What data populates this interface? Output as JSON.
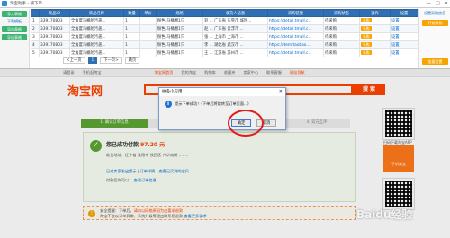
{
  "window": {
    "title": "淘宝助手 - 铺下单"
  },
  "left_panel": {
    "buttons": [
      {
        "label": "导入表格"
      },
      {
        "label": "下载模板"
      },
      {
        "label": "导出表格"
      },
      {
        "label": "导出表格"
      }
    ],
    "link": "下载模板"
  },
  "table": {
    "headers": [
      "",
      "商品ID",
      "商品名称",
      "数量",
      "单价",
      "规格",
      "收货人信息",
      "采购链接",
      "采购状态",
      "操作",
      "设置"
    ],
    "rows": [
      [
        "1",
        "339170803",
        "全角度马桶防汚盖...",
        "1",
        "",
        "粉色-马桶圈1只",
        "刘 ... 广东省 东莞市 城区...",
        "https://detail.tmall.c...",
        "待采购",
        "采购",
        "设置"
      ],
      [
        "2",
        "339170803",
        "全角度马桶防汚盖...",
        "1",
        "",
        "粉色-马桶圈1只",
        "赵 ... 广东省 云浮市 ...",
        "https://detail.tmall.c...",
        "待采购",
        "采购",
        "设置"
      ],
      [
        "3",
        "339170803",
        "全角度马桶防汚盖...",
        "1",
        "",
        "粉色-马桶圈1只",
        "张 ... 上海市 上海市 ...",
        "https://detail.tmall.c...",
        "待采购",
        "采购",
        "设置"
      ],
      [
        "4",
        "339170803",
        "全角度马桶防汚盖...",
        "1",
        "",
        "粉色-马桶圈1只",
        "李 ... 湖北省 武汉市 ...",
        "https://item.taobao....",
        "待采购",
        "采购",
        "设置"
      ],
      [
        "5",
        "339170803",
        "全角度马桶防汚盖...",
        "1",
        "",
        "粉色-马桶圈1只",
        "王 ... 江苏省 苏州市 ...",
        "https://detail.tmall.c...",
        "待采购",
        "采购",
        "设置"
      ]
    ]
  },
  "right_panel": {
    "title": "设置采购信息",
    "buttons": [
      "开始采购",
      "批量设置"
    ]
  },
  "pager": {
    "items": [
      "<上一页",
      "1",
      "下一页>",
      "跳页"
    ]
  },
  "web": {
    "topnav": [
      "淘宝网首页",
      "我的淘宝",
      "购物车",
      "收藏夹",
      "卖家中心",
      "联系客服",
      "网站导航"
    ],
    "topnav_left": [
      "请登录",
      "手机逛淘宝"
    ],
    "logo": "淘宝网",
    "search_button": "搜 索",
    "steps": [
      "1. 确认订单信息",
      "2. 付款到支付宝",
      "3. 确认收货",
      "4. 双方互评"
    ],
    "pay": {
      "headline": "您已成功付款",
      "amount": "97.20 元",
      "line1": "收货地址：辽宁省 沈阳市 铁西区 兴华南街 ........",
      "line2_a": "已对卖家发出提示",
      "line2_b": "订单详情",
      "line2_c": "查看已买到的宝贝",
      "line3": "付款后你可以：",
      "line3_link": "查看订单信息"
    },
    "notice": {
      "text1": "安全提醒：下单后，",
      "text2": "请勿以网络原因为由要求退款",
      "text3": "淘宝不会以订单异常、系统升级等理由联系您退款",
      "link": "查看更多骗术"
    },
    "side": [
      "扫码下载淘宝APP",
      "手机淘宝"
    ]
  },
  "dialog": {
    "title": "拍多小应用",
    "message": "提示下单成功！(下单后将跳转至订单页面...)",
    "ok": "确定",
    "cancel": "取消"
  },
  "watermark": "Baidu经验"
}
